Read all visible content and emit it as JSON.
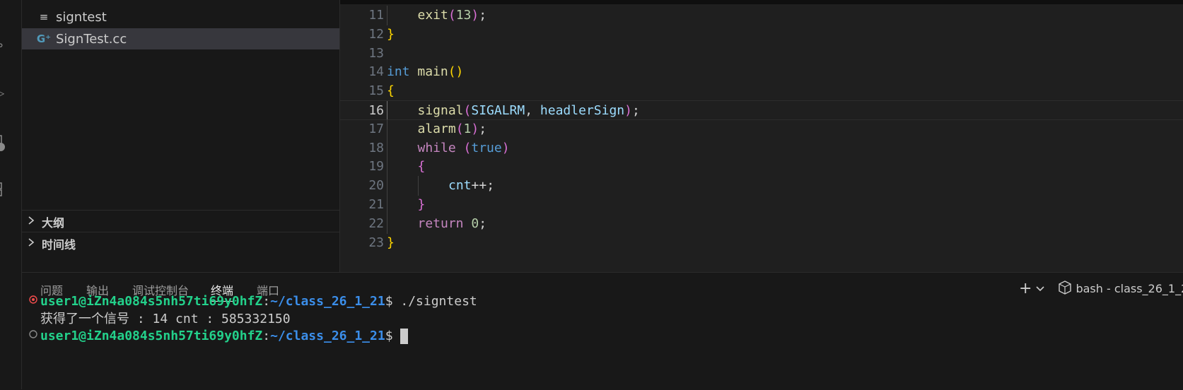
{
  "explorer": {
    "files": [
      {
        "name": "signtest",
        "icon": "file-lines-icon",
        "selected": false
      },
      {
        "name": "SignTest.cc",
        "icon": "cpp-file-icon",
        "selected": true
      }
    ],
    "sections": [
      {
        "label": "大纲",
        "icon": "chevron-right-icon"
      },
      {
        "label": "时间线",
        "icon": "chevron-right-icon"
      }
    ]
  },
  "editor": {
    "current_line": "16",
    "lines": [
      {
        "num": "11",
        "tokens": [
          {
            "t": "exit",
            "c": "fn"
          },
          {
            "t": "(",
            "c": "b2"
          },
          {
            "t": "13",
            "c": "num"
          },
          {
            "t": ")",
            "c": "b2"
          },
          {
            "t": ";",
            "c": "txt"
          }
        ]
      },
      {
        "num": "12",
        "tokens": [
          {
            "t": "}",
            "c": "b1"
          }
        ]
      },
      {
        "num": "13",
        "tokens": []
      },
      {
        "num": "14",
        "tokens": [
          {
            "t": "int",
            "c": "k-blue"
          },
          {
            "t": " ",
            "c": "txt"
          },
          {
            "t": "main",
            "c": "fn"
          },
          {
            "t": "()",
            "c": "b1"
          }
        ]
      },
      {
        "num": "15",
        "tokens": [
          {
            "t": "{",
            "c": "b1"
          }
        ]
      },
      {
        "num": "16",
        "tokens": [
          {
            "t": "signal",
            "c": "fn"
          },
          {
            "t": "(",
            "c": "b2"
          },
          {
            "t": "SIGALRM",
            "c": "var"
          },
          {
            "t": ", ",
            "c": "txt"
          },
          {
            "t": "headlerSign",
            "c": "var"
          },
          {
            "t": ")",
            "c": "b2"
          },
          {
            "t": ";",
            "c": "txt"
          }
        ]
      },
      {
        "num": "17",
        "tokens": [
          {
            "t": "alarm",
            "c": "fn"
          },
          {
            "t": "(",
            "c": "b2"
          },
          {
            "t": "1",
            "c": "num"
          },
          {
            "t": ")",
            "c": "b2"
          },
          {
            "t": ";",
            "c": "txt"
          }
        ]
      },
      {
        "num": "18",
        "tokens": [
          {
            "t": "while",
            "c": "k-pur"
          },
          {
            "t": " ",
            "c": "txt"
          },
          {
            "t": "(",
            "c": "b2"
          },
          {
            "t": "true",
            "c": "k-blue"
          },
          {
            "t": ")",
            "c": "b2"
          }
        ]
      },
      {
        "num": "19",
        "tokens": [
          {
            "t": "{",
            "c": "b2"
          }
        ]
      },
      {
        "num": "20",
        "tokens": [
          {
            "t": "cnt",
            "c": "var"
          },
          {
            "t": "++;",
            "c": "txt"
          }
        ]
      },
      {
        "num": "21",
        "tokens": [
          {
            "t": "}",
            "c": "b2"
          }
        ]
      },
      {
        "num": "22",
        "tokens": [
          {
            "t": "return",
            "c": "k-pur"
          },
          {
            "t": " ",
            "c": "txt"
          },
          {
            "t": "0",
            "c": "num"
          },
          {
            "t": ";",
            "c": "txt"
          }
        ]
      },
      {
        "num": "23",
        "tokens": [
          {
            "t": "}",
            "c": "b1"
          }
        ]
      }
    ]
  },
  "panel": {
    "tabs": [
      {
        "label": "问题",
        "active": false
      },
      {
        "label": "输出",
        "active": false
      },
      {
        "label": "调试控制台",
        "active": false
      },
      {
        "label": "终端",
        "active": true
      },
      {
        "label": "端口",
        "active": false
      }
    ],
    "add_icon": "plus-icon",
    "dropdown_icon": "chevron-down-icon",
    "terminal_icon": "terminal-cube-icon",
    "terminal_name": "bash - class_26_1_2"
  },
  "terminal": {
    "lines": [
      {
        "deco": "error-circle-icon",
        "user": "user1@iZn4a084s5nh57ti69y0hfZ",
        "sep": ":",
        "path": "~/class_26_1_21",
        "prompt": "$ ",
        "cmd": "./signtest"
      },
      {
        "output": "获得了一个信号 : 14 cnt : 585332150"
      },
      {
        "deco": "empty-circle-icon",
        "user": "user1@iZn4a084s5nh57ti69y0hfZ",
        "sep": ":",
        "path": "~/class_26_1_21",
        "prompt": "$ ",
        "cmd": "",
        "cursor": true
      }
    ]
  },
  "colors": {
    "accent": "#0078d4",
    "terminal_user": "#23d18b",
    "terminal_path": "#3b8eea",
    "error": "#f14c4c"
  }
}
